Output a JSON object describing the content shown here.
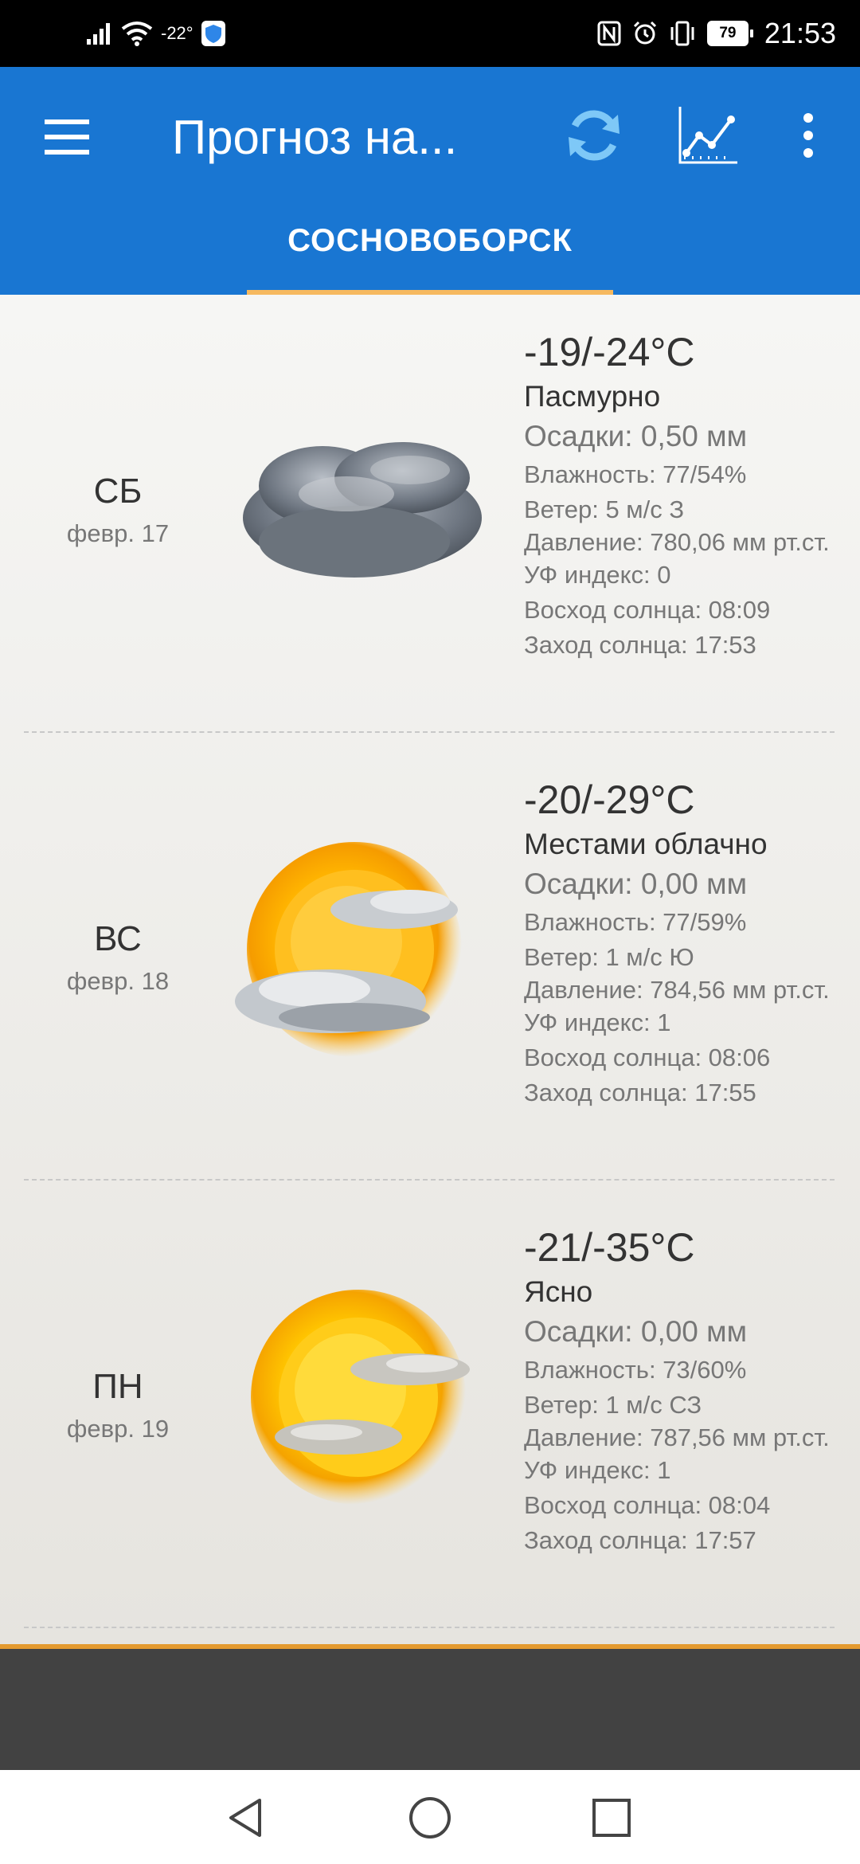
{
  "status_bar": {
    "signal_icon": "cell-signal-icon",
    "wifi_icon": "wifi-icon",
    "temperature": "-22°",
    "shield_icon": "shield-icon",
    "nfc_icon": "nfc-icon",
    "alarm_icon": "alarm-icon",
    "vibrate_icon": "vibrate-icon",
    "battery": "79",
    "time": "21:53"
  },
  "app_bar": {
    "color": "#1976d2",
    "title": "Прогноз на...",
    "menu_icon": "hamburger-menu-icon",
    "refresh_icon": "refresh-icon",
    "chart_icon": "line-chart-icon",
    "more_icon": "more-vert-icon"
  },
  "tabs": [
    {
      "label": "СОСНОВОБОРСК",
      "selected": true
    }
  ],
  "forecast": [
    {
      "dow": "СБ",
      "date": "февр. 17",
      "icon": "overcast-cloud-icon",
      "temp": "-19/-24°C",
      "condition": "Пасмурно",
      "precip": "Осадки: 0,50 мм",
      "humidity": "Влажность: 77/54%",
      "wind": "Ветер: 5 м/с З",
      "pressure": "Давление: 780,06 мм рт.ст.",
      "uv": "УФ индекс: 0",
      "sunrise": "Восход солнца:  08:09",
      "sunset": "Заход солнца:  17:53"
    },
    {
      "dow": "ВС",
      "date": "февр. 18",
      "icon": "partly-cloudy-sun-icon",
      "temp": "-20/-29°C",
      "condition": "Местами облачно",
      "precip": "Осадки: 0,00 мм",
      "humidity": "Влажность: 77/59%",
      "wind": "Ветер: 1 м/с Ю",
      "pressure": "Давление: 784,56 мм рт.ст.",
      "uv": "УФ индекс: 1",
      "sunrise": "Восход солнца:  08:06",
      "sunset": "Заход солнца:  17:55"
    },
    {
      "dow": "ПН",
      "date": "февр. 19",
      "icon": "sunny-thin-clouds-icon",
      "temp": "-21/-35°C",
      "condition": "Ясно",
      "precip": "Осадки: 0,00 мм",
      "humidity": "Влажность: 73/60%",
      "wind": "Ветер: 1 м/с СЗ",
      "pressure": "Давление: 787,56 мм рт.ст.",
      "uv": "УФ индекс: 1",
      "sunrise": "Восход солнца:  08:04",
      "sunset": "Заход солнца:  17:57"
    }
  ],
  "nav_bar": {
    "back_icon": "back-triangle-icon",
    "home_icon": "home-circle-icon",
    "recents_icon": "recents-square-icon"
  }
}
